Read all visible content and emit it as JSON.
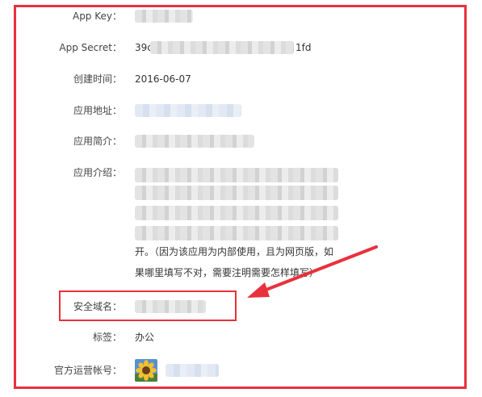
{
  "fields": {
    "app_key": {
      "label": "App Key："
    },
    "app_secret": {
      "label": "App Secret：",
      "value_start": "39c",
      "value_end": "1fd"
    },
    "created": {
      "label": "创建时间：",
      "value": "2016-06-07"
    },
    "app_url": {
      "label": "应用地址："
    },
    "summary": {
      "label": "应用简介："
    },
    "intro": {
      "label": "应用介绍：",
      "line_a": "开。（因为该应用为内部使用，且为网页版，如",
      "line_b": "果哪里填写不对，需要注明需要怎样填写）"
    },
    "domain": {
      "label": "安全域名："
    },
    "tags": {
      "label": "标签：",
      "value": "办公"
    },
    "account": {
      "label": "官方运营帐号："
    }
  },
  "colors": {
    "highlight": "#e8313c",
    "text": "#333333",
    "label": "#444444"
  },
  "icons": {
    "avatar": "sunflower-avatar-icon",
    "pointer": "red-arrow-annotation"
  }
}
